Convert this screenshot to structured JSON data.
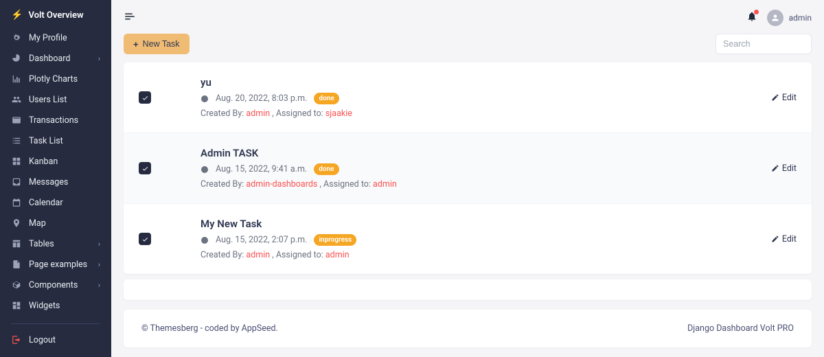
{
  "brand": {
    "name": "Volt Overview"
  },
  "sidebar": {
    "items": [
      {
        "icon": "gear",
        "label": "My Profile",
        "chevron": false
      },
      {
        "icon": "pie",
        "label": "Dashboard",
        "chevron": true
      },
      {
        "icon": "chart",
        "label": "Plotly Charts",
        "chevron": false
      },
      {
        "icon": "users",
        "label": "Users List",
        "chevron": false
      },
      {
        "icon": "card",
        "label": "Transactions",
        "chevron": false
      },
      {
        "icon": "list",
        "label": "Task List",
        "chevron": false
      },
      {
        "icon": "grid",
        "label": "Kanban",
        "chevron": false
      },
      {
        "icon": "inbox",
        "label": "Messages",
        "chevron": false
      },
      {
        "icon": "calendar",
        "label": "Calendar",
        "chevron": false
      },
      {
        "icon": "pin",
        "label": "Map",
        "chevron": false
      },
      {
        "icon": "table",
        "label": "Tables",
        "chevron": true
      },
      {
        "icon": "file",
        "label": "Page examples",
        "chevron": true
      },
      {
        "icon": "box",
        "label": "Components",
        "chevron": true
      },
      {
        "icon": "widget",
        "label": "Widgets",
        "chevron": false
      }
    ],
    "logout_label": "Logout"
  },
  "topbar": {
    "username": "admin"
  },
  "toolbar": {
    "new_task_label": "New Task",
    "search_placeholder": "Search"
  },
  "tasks": [
    {
      "title": "yu",
      "datetime": "Aug. 20, 2022, 8:03 p.m.",
      "status": "done",
      "created_by_label": "Created By: ",
      "created_by": "admin",
      "assigned_to_label": " , Assigned to: ",
      "assigned_to": "sjaakie",
      "edit_label": "Edit"
    },
    {
      "title": "Admin TASK",
      "datetime": "Aug. 15, 2022, 9:41 a.m.",
      "status": "done",
      "created_by_label": "Created By: ",
      "created_by": "admin-dashboards",
      "assigned_to_label": " , Assigned to: ",
      "assigned_to": "admin",
      "edit_label": "Edit"
    },
    {
      "title": "My New Task",
      "datetime": "Aug. 15, 2022, 2:07 p.m.",
      "status": "inprogress",
      "created_by_label": "Created By: ",
      "created_by": "admin",
      "assigned_to_label": " , Assigned to: ",
      "assigned_to": "admin",
      "edit_label": "Edit"
    }
  ],
  "footer": {
    "left": "© Themesberg - coded by AppSeed.",
    "right": "Django Dashboard Volt PRO"
  }
}
